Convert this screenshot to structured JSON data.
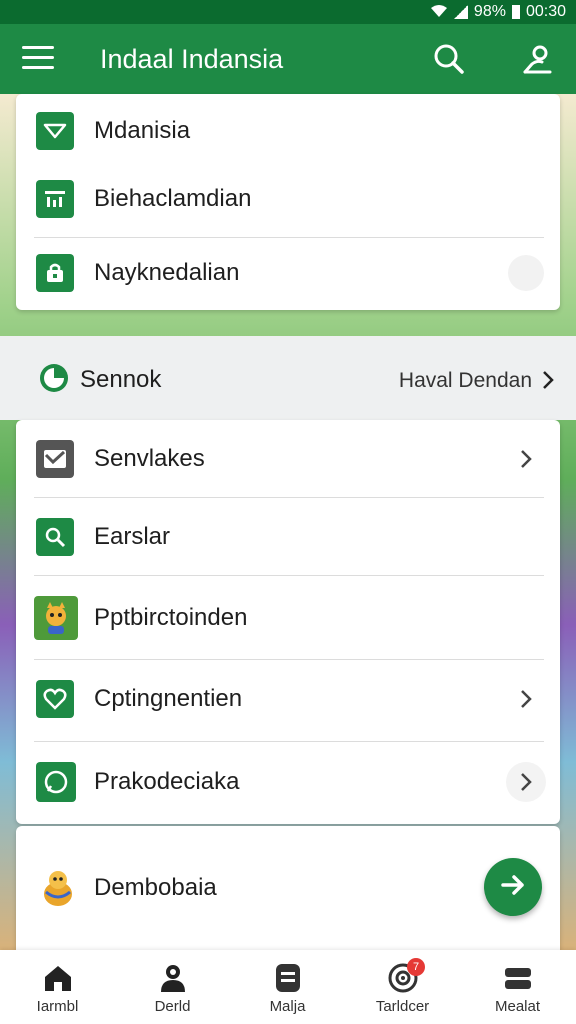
{
  "status_bar": {
    "battery": "98%",
    "time": "00:30"
  },
  "app_bar": {
    "title": "Indaal Indansia"
  },
  "top_card": {
    "items": [
      {
        "label": "Mdanisia",
        "icon": "envelope-icon"
      },
      {
        "label": "Biehaclamdian",
        "icon": "chart-icon"
      },
      {
        "label": "Nayknedalian",
        "icon": "bag-icon"
      }
    ]
  },
  "section": {
    "label": "Sennok",
    "link": "Haval Dendan",
    "icon": "clock-icon"
  },
  "list_card": {
    "items": [
      {
        "label": "Senvlakes",
        "icon": "mail-icon",
        "chevron": true
      },
      {
        "label": "Earslar",
        "icon": "search-icon",
        "chevron": false
      },
      {
        "label": "Pptbirctoinden",
        "icon": "game-character-icon",
        "chevron": false
      },
      {
        "label": "Cptingnentien",
        "icon": "heart-icon",
        "chevron": true
      },
      {
        "label": "Prakodeciaka",
        "icon": "chat-icon",
        "chevron": true
      }
    ]
  },
  "bottom_card": {
    "label": "Dembobaia",
    "icon": "character-icon"
  },
  "bottom_nav": {
    "items": [
      {
        "label": "Iarmbl",
        "icon": "home-icon"
      },
      {
        "label": "Derld",
        "icon": "person-icon"
      },
      {
        "label": "Malja",
        "icon": "document-icon"
      },
      {
        "label": "Tarldcer",
        "icon": "target-icon",
        "badge": "7"
      },
      {
        "label": "Mealat",
        "icon": "stack-icon"
      }
    ]
  },
  "colors": {
    "primary": "#1e8a45",
    "primary_dark": "#0b6b2f",
    "badge": "#e53935"
  }
}
